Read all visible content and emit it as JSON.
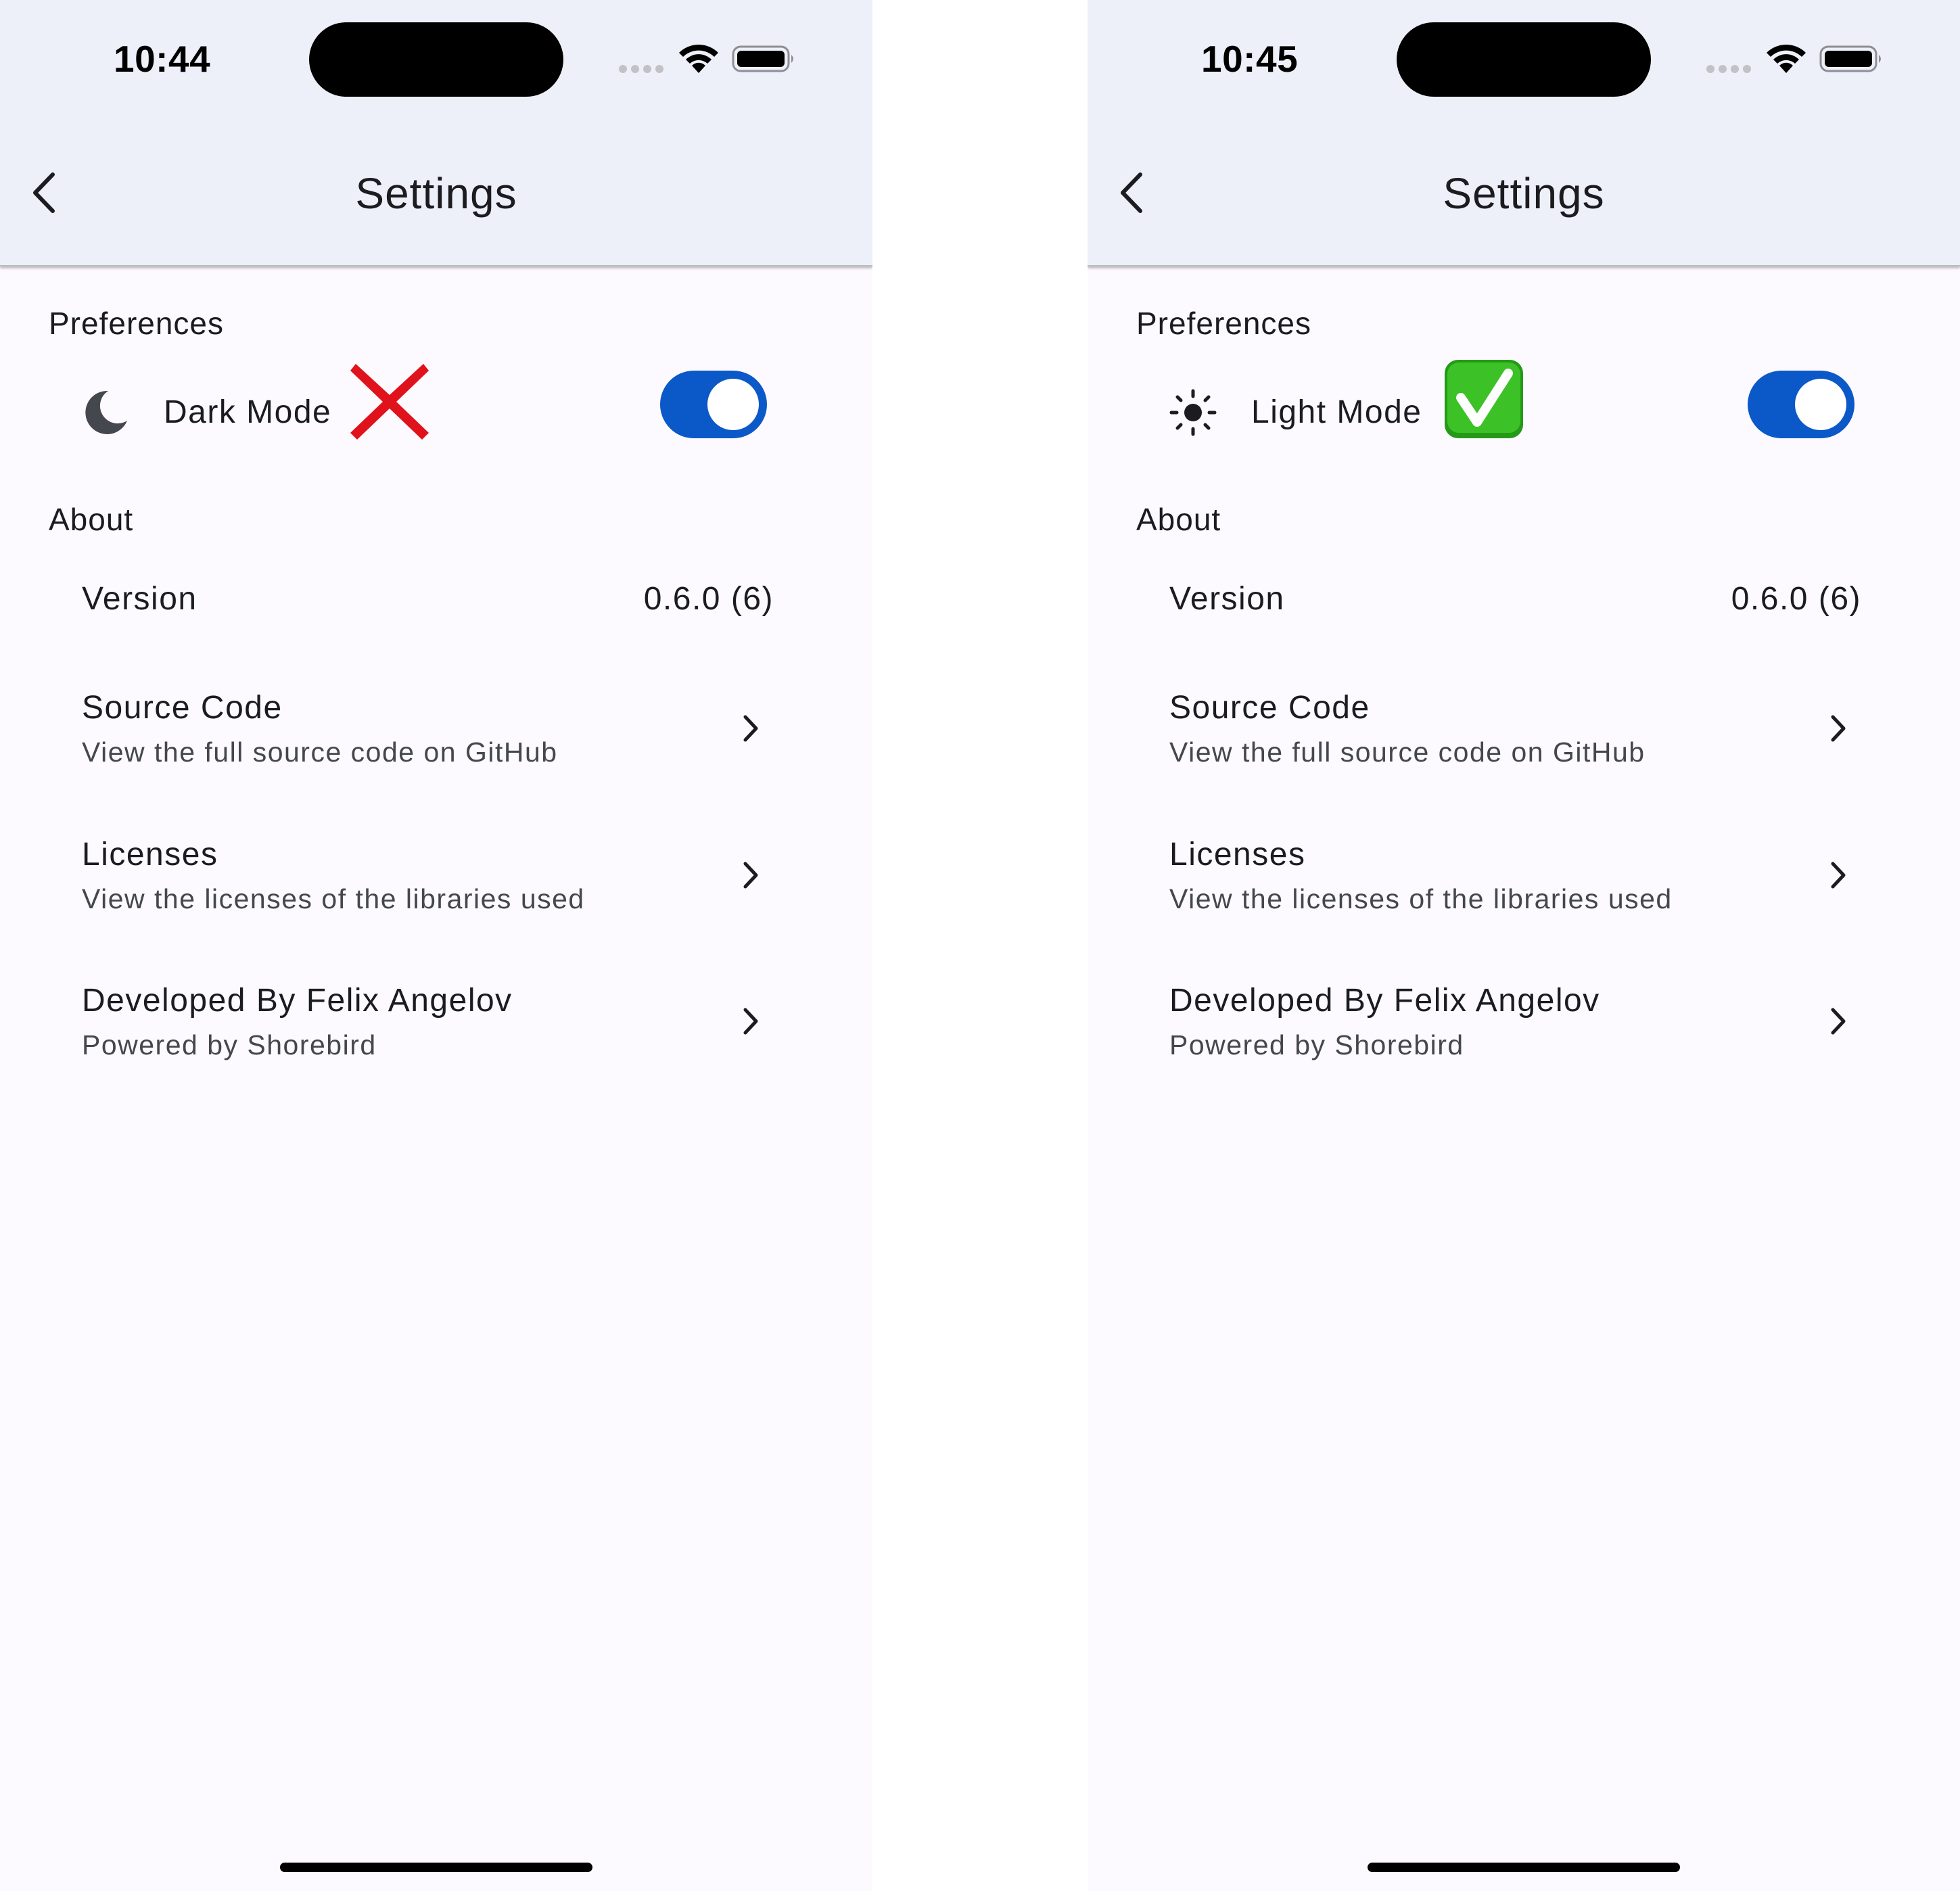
{
  "colors": {
    "app_bar_bg": "#edf0f8",
    "page_bg": "#fcfafe",
    "toggle_on": "#0b58c8",
    "x_mark": "#e0121c",
    "check_bg": "#2fb51f"
  },
  "screens": [
    {
      "status_bar": {
        "time": "10:44",
        "icons": [
          "signal-dots-icon",
          "wifi-icon",
          "battery-icon"
        ]
      },
      "app_bar": {
        "title": "Settings",
        "back_icon": "chevron-left-icon"
      },
      "preferences": {
        "header": "Preferences",
        "mode_icon": "moon-icon",
        "mode_label": "Dark Mode",
        "badge_emoji": "cross-mark-icon",
        "toggle_on": true
      },
      "about": {
        "header": "About",
        "version_label": "Version",
        "version_value": "0.6.0 (6)",
        "items": [
          {
            "title": "Source Code",
            "subtitle": "View the full source code on GitHub"
          },
          {
            "title": "Licenses",
            "subtitle": "View the licenses of the libraries used"
          },
          {
            "title": "Developed By Felix Angelov",
            "subtitle": "Powered by Shorebird"
          }
        ]
      }
    },
    {
      "status_bar": {
        "time": "10:45",
        "icons": [
          "signal-dots-icon",
          "wifi-icon",
          "battery-icon"
        ]
      },
      "app_bar": {
        "title": "Settings",
        "back_icon": "chevron-left-icon"
      },
      "preferences": {
        "header": "Preferences",
        "mode_icon": "sun-icon",
        "mode_label": "Light Mode",
        "badge_emoji": "check-mark-button-icon",
        "toggle_on": true
      },
      "about": {
        "header": "About",
        "version_label": "Version",
        "version_value": "0.6.0 (6)",
        "items": [
          {
            "title": "Source Code",
            "subtitle": "View the full source code on GitHub"
          },
          {
            "title": "Licenses",
            "subtitle": "View the licenses of the libraries used"
          },
          {
            "title": "Developed By Felix Angelov",
            "subtitle": "Powered by Shorebird"
          }
        ]
      }
    }
  ]
}
